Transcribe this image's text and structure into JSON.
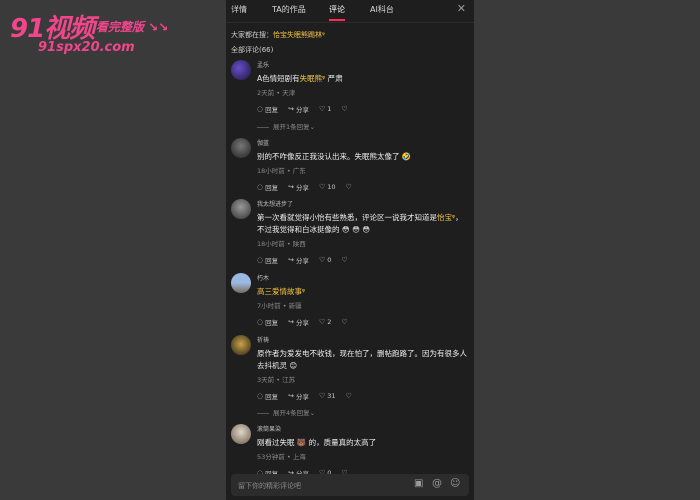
{
  "watermark": {
    "brand": "91视频",
    "slogan": "看完整版 ↘↘",
    "url": "91spx20.com"
  },
  "tabs": [
    {
      "label": "详情",
      "active": false
    },
    {
      "label": "TA的作品",
      "active": false
    },
    {
      "label": "评论",
      "active": true
    },
    {
      "label": "AI科台",
      "active": false
    }
  ],
  "searching": {
    "prefix": "大家都在搜：",
    "keyword": "恰宝失眠熊踢林"
  },
  "comment_count": "全部评论(66)",
  "comments": [
    {
      "user": "孟乐",
      "text_pre": "A色情短剧有",
      "text_hl": "失眠熊",
      "text_post": " 严肃",
      "meta": "2天前 • 天津",
      "reply": "回复",
      "share": "分享",
      "likes": "1",
      "expand": "展开1条回复"
    },
    {
      "user": "伽蓝",
      "text_pre": "别的不咋像反正我没认出来。失眠熊太像了 🤣",
      "text_hl": "",
      "text_post": "",
      "meta": "18小时前 • 广东",
      "reply": "回复",
      "share": "分享",
      "likes": "10",
      "expand": ""
    },
    {
      "user": "我太想进步了",
      "text_pre": "第一次看就觉得小怡有些熟悉，评论区一说我才知道是",
      "text_hl": "怡宝",
      "text_post": "，不过我觉得和白冰挺像的 😳 😳 😳",
      "meta": "18小时前 • 陕西",
      "reply": "回复",
      "share": "分享",
      "likes": "0",
      "expand": ""
    },
    {
      "user": "朽木",
      "text_pre": "",
      "text_hl": "高三爱情故事",
      "text_post": "",
      "meta": "7小时前 • 新疆",
      "reply": "回复",
      "share": "分享",
      "likes": "2",
      "expand": ""
    },
    {
      "user": "祈祷",
      "text_pre": "原作者为爱发电不收钱，现在怕了，删帖跑路了。因为有很多人去抖机灵 😊",
      "text_hl": "",
      "text_post": "",
      "meta": "3天前 • 江苏",
      "reply": "回复",
      "share": "分享",
      "likes": "31",
      "expand": "展开4条回复"
    },
    {
      "user": "滚筒果染",
      "text_pre": "刚看过失眠 🐻 的，质量真的太高了",
      "text_hl": "",
      "text_post": "",
      "meta": "53分钟前 • 上海",
      "reply": "回复",
      "share": "分享",
      "likes": "0",
      "expand": ""
    }
  ],
  "input": {
    "placeholder": "留下你的精彩评论吧"
  },
  "icons": {
    "close": "close-icon",
    "reply": "comment-icon",
    "share": "share-icon",
    "like": "heart-icon",
    "dislike": "broken-heart-icon",
    "image": "image-icon",
    "mention": "at-icon",
    "emoji": "emoji-icon"
  },
  "colors": {
    "accent": "#fe2c55",
    "highlight": "#f5c542",
    "panel": "#1e1e1e",
    "backdrop": "#3a3a3a"
  }
}
